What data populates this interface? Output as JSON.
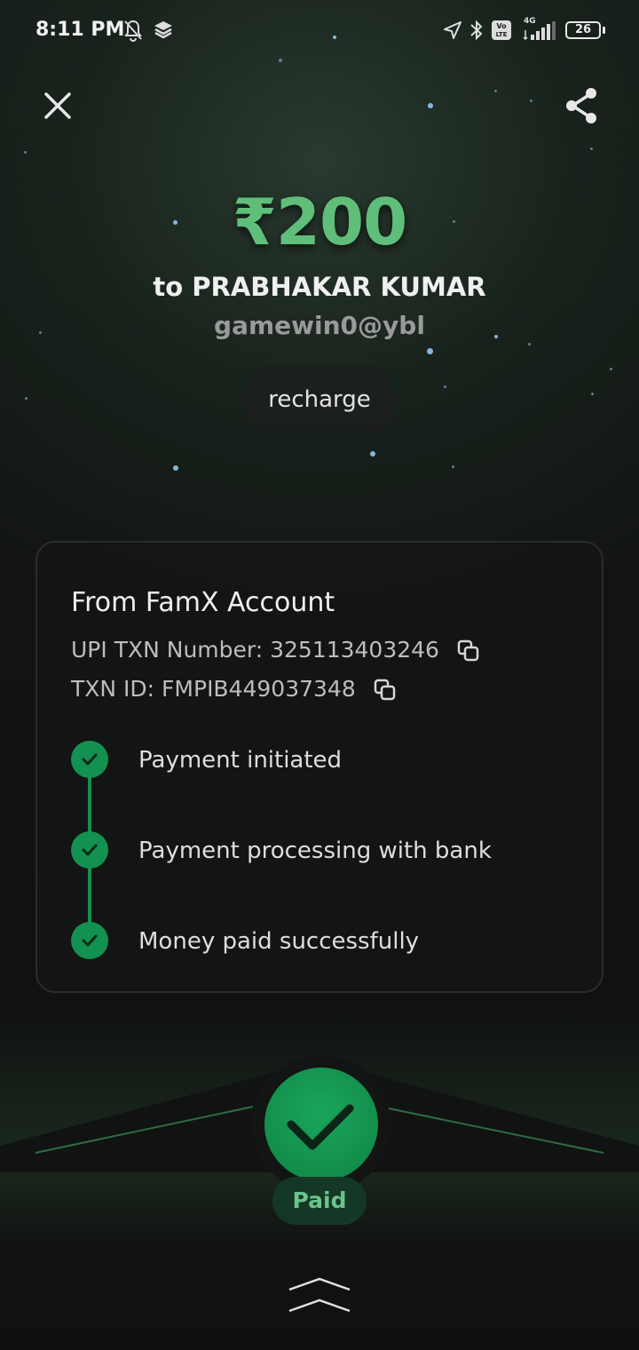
{
  "status_bar": {
    "time": "8:11 PM",
    "battery": "26",
    "network": "4G",
    "icons": [
      "bell-off-icon",
      "layers-icon",
      "location-arrow-icon",
      "bluetooth-icon",
      "volte-icon",
      "signal-icon",
      "battery-icon"
    ]
  },
  "header": {
    "close_icon": "close-icon",
    "share_icon": "share-icon"
  },
  "payment": {
    "amount": "₹200",
    "recipient": "to PRABHAKAR KUMAR",
    "upi_id": "gamewin0@ybl",
    "note": "recharge"
  },
  "details": {
    "title": "From FamX Account",
    "upi_txn": "UPI TXN Number: 325113403246",
    "txn_id": "TXN ID: FMPIB449037348",
    "steps": [
      {
        "label": "Payment initiated",
        "status": "done"
      },
      {
        "label": "Payment processing with bank",
        "status": "done"
      },
      {
        "label": "Money paid successfully",
        "status": "done"
      }
    ]
  },
  "result": {
    "label": "Paid"
  },
  "colors": {
    "accent": "#139150",
    "amount": "#5fbf7a",
    "paid_text": "#6bc48a"
  }
}
